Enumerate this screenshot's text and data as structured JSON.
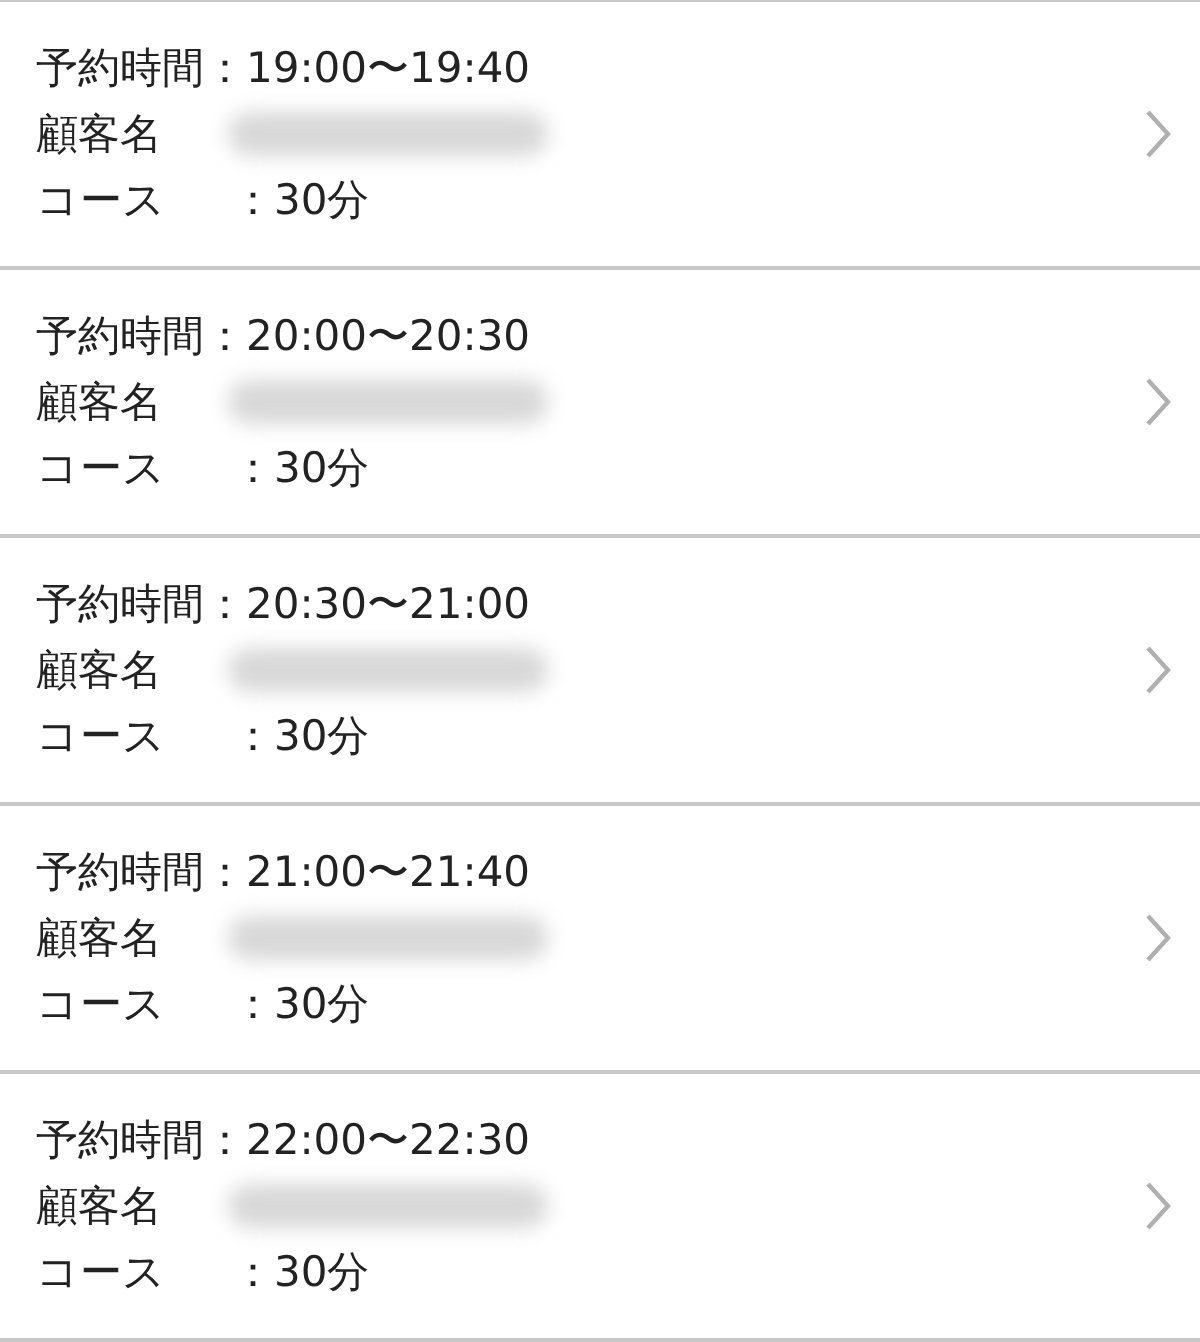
{
  "reservations": [
    {
      "time_label": "予約時間",
      "time": "：19:00〜19:40",
      "customer_label": "顧客名",
      "course_label": "コース",
      "course": "：30分"
    },
    {
      "time_label": "予約時間",
      "time": "：20:00〜20:30",
      "customer_label": "顧客名",
      "course_label": "コース",
      "course": "：30分"
    },
    {
      "time_label": "予約時間",
      "time": "：20:30〜21:00",
      "customer_label": "顧客名",
      "course_label": "コース",
      "course": "：30分"
    },
    {
      "time_label": "予約時間",
      "time": "：21:00〜21:40",
      "customer_label": "顧客名",
      "course_label": "コース",
      "course": "：30分"
    },
    {
      "time_label": "予約時間",
      "time": "：22:00〜22:30",
      "customer_label": "顧客名",
      "course_label": "コース",
      "course": "：30分"
    }
  ]
}
